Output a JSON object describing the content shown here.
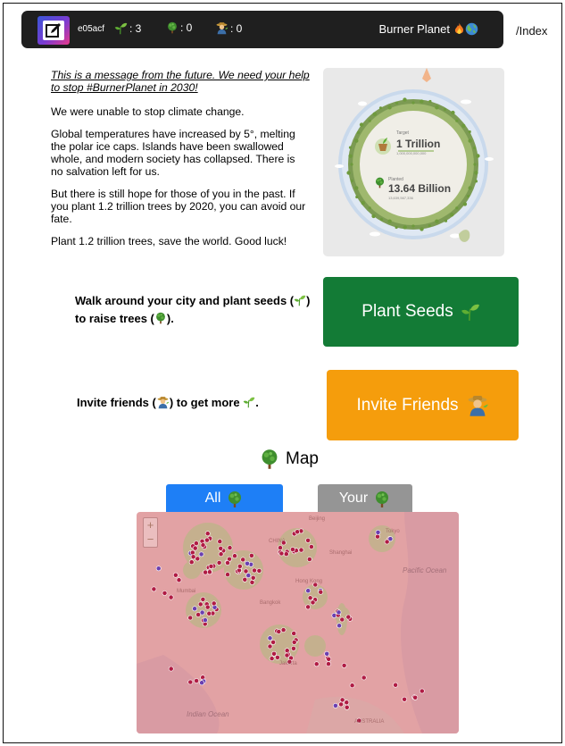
{
  "header": {
    "user_id": "e05acf",
    "seeds_count": ": 3",
    "trees_count": ": 0",
    "friends_count": ": 0",
    "app_title": "Burner Planet"
  },
  "nav": {
    "index_link": "/Index"
  },
  "message": {
    "future_notice": "This is a message from the future. We need your help to stop #BurnerPlanet in 2030!",
    "p1": "We were unable to stop climate change.",
    "p2": "Global temperatures have increased by 5°, melting the polar ice caps. Islands have been swallowed whole, and modern society has collapsed. There is no salvation left for us.",
    "p3": "But there is still hope for those of you in the past. If you plant 1.2 trillion trees by 2020, you can avoid our fate.",
    "p4": "Plant 1.2 trillion trees, save the world. Good luck!"
  },
  "planet": {
    "target_label": "Target",
    "target_value": "1 Trillion",
    "target_exact": "1,000,000,000,000",
    "planted_label": "Planted",
    "planted_value": "13.64 Billion",
    "planted_exact": "13,639,567,336"
  },
  "actions": {
    "plant_text_a": "Walk around your city and plant seeds (",
    "plant_text_b": ") to raise trees (",
    "plant_text_c": ").",
    "plant_button": "Plant Seeds",
    "invite_text_a": "Invite friends (",
    "invite_text_b": ") to get more",
    "invite_text_c": ".",
    "invite_button": "Invite Friends"
  },
  "map": {
    "heading": "Map",
    "tab_all": "All",
    "tab_your": "Your",
    "zoom_in": "+",
    "zoom_out": "−",
    "labels": {
      "beijing": "Beijing",
      "tokyo": "Tokyo",
      "china": "CHINA",
      "shanghai": "Shanghai",
      "hong_kong": "Hong Kong",
      "mumbai": "Mumbai",
      "bangkok": "Bangkok",
      "jakarta": "Jakarta",
      "australia": "AUSTRALIA",
      "pacific_ocean": "Pacific Ocean",
      "indian_ocean": "Indian Ocean"
    }
  },
  "icons": {
    "seedling": "seedling-icon",
    "tree": "tree-icon",
    "farmer": "farmer-icon",
    "fire": "fire-icon",
    "globe": "globe-icon",
    "edit": "edit-icon"
  },
  "colors": {
    "header_bg": "#1f1f1f",
    "plant_button": "#137b36",
    "invite_button": "#f59d0c",
    "tab_all": "#1e7ff6",
    "tab_your": "#959595",
    "map_tint": "#e2a2a4"
  }
}
